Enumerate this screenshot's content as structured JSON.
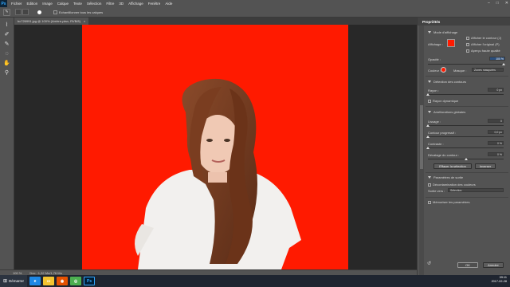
{
  "app": {
    "logo": "Ps"
  },
  "menu": [
    "Fichier",
    "Edition",
    "Image",
    "Calque",
    "Texte",
    "Sélection",
    "Filtre",
    "3D",
    "Affichage",
    "Fenêtre",
    "Aide"
  ],
  "options_bar": {
    "label": "Echantillonner tous les calques"
  },
  "document": {
    "tab_title": "bc726991.jpg @ 100% (Arrière-plan, RVB/8)",
    "close": "×"
  },
  "status": {
    "zoom": "100 %",
    "doc_info": "Doc : 1,32 Mo/1,76 Mo"
  },
  "properties": {
    "title": "Propriétés",
    "view_mode": {
      "label": "Mode d'affichage",
      "display_label": "Affichage :",
      "show_edge": "Afficher le contour (J)",
      "show_original": "Afficher l'original (P)",
      "high_quality": "Aperçu haute qualité"
    },
    "opacity": {
      "label": "Opacité :",
      "value": "100 %",
      "level": 1.0
    },
    "color": {
      "label": "Couleur :",
      "swatch": "#ff1a00",
      "layer_label": "Masque :",
      "layer_value": "Zones masquées"
    },
    "edge_detection": {
      "section": "Détection des contours",
      "radius_label": "Rayon :",
      "radius_value": "0 px",
      "radius_level": 0.0,
      "smart_radius": "Rayon dynamique"
    },
    "global_refinements": {
      "section": "Améliorations globales",
      "smooth_label": "Lissage :",
      "smooth_value": "0",
      "smooth_level": 0.0,
      "feather_label": "Contour progressif :",
      "feather_value": "0,0 px",
      "feather_level": 0.0,
      "contrast_label": "Contraste :",
      "contrast_value": "0 %",
      "contrast_level": 0.0,
      "shift_edge_label": "Décalage du contour :",
      "shift_edge_value": "0 %",
      "shift_edge_level": 0.5,
      "clear_selection": "Effacer la sélection",
      "invert": "Inverser"
    },
    "output": {
      "section": "Paramètres de sortie",
      "decontaminate": "Décontamination des couleurs",
      "output_to_label": "Sortie vers :",
      "output_to_value": "Sélection",
      "remember": "Mémoriser les paramètres"
    },
    "ok": "OK",
    "cancel": "Annuler"
  },
  "taskbar": {
    "start_label": "Démarrer",
    "apps": [
      "IE",
      "Fichiers",
      "Firefox",
      "Chrome",
      "Photoshop"
    ],
    "app_colors": [
      "#1e88e5",
      "#f4c430",
      "#e65100",
      "#4caf50",
      "#001e36"
    ],
    "app_glyphs": [
      "e",
      "▭",
      "◉",
      "◎",
      "Ps"
    ],
    "clock_time": "09:11",
    "clock_date": "2017-02-28"
  }
}
